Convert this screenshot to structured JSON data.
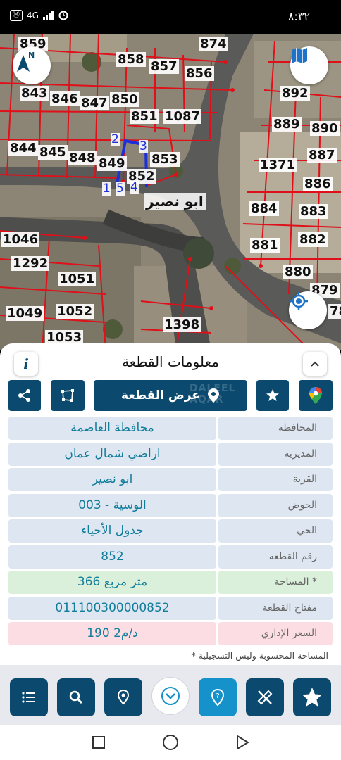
{
  "status_bar": {
    "left_badge": "Ⓜ",
    "network": "4G",
    "time": "٨:٣٢"
  },
  "map": {
    "parcel_numbers": [
      "859",
      "874",
      "858",
      "857",
      "856",
      "843",
      "846",
      "847",
      "850",
      "851",
      "1087",
      "892",
      "889",
      "890",
      "844",
      "845",
      "848",
      "849",
      "853",
      "852",
      "887",
      "1371",
      "886",
      "884",
      "883",
      "881",
      "882",
      "1046",
      "1292",
      "1051",
      "880",
      "879",
      "1049",
      "1052",
      "1053",
      "1398",
      "78"
    ],
    "corner_labels": [
      "2",
      "3",
      "1",
      "5",
      "4"
    ],
    "area_name": "ابو نصير",
    "compass_letter": "N"
  },
  "sheet": {
    "title": "معلومات القطعة",
    "info_label": "i",
    "show_parcel_label": "عرض القطعة",
    "watermark": "DALEEL AQAR",
    "rows": [
      {
        "label": "المحافظة",
        "value": "محافظة العاصمة"
      },
      {
        "label": "المديرية",
        "value": "اراضي شمال عمان"
      },
      {
        "label": "القرية",
        "value": "ابو نصير"
      },
      {
        "label": "الحوض",
        "value": "الوسية - 003"
      },
      {
        "label": "الحي",
        "value": "جدول الأحياء"
      },
      {
        "label": "رقم القطعة",
        "value": "852"
      },
      {
        "label": "المساحة *",
        "value": "366  متر مربع"
      },
      {
        "label": "مفتاح القطعة",
        "value": "011100300000852"
      },
      {
        "label": "السعر الإداري",
        "value": "190 د/م2"
      }
    ],
    "note": "* المساحة المحسوبة وليس التسجيلية"
  },
  "colors": {
    "primary": "#0b4a6e",
    "active": "#1592c9",
    "row_bg": "#dde6f1",
    "area_bg": "#daf0da",
    "price_bg": "#fbdde3",
    "value_text": "#117d9a",
    "parcel_line": "#e0101a",
    "selected_parcel": "#1d2fd8"
  },
  "icons": [
    "menu-icon",
    "search-icon",
    "location-pin-icon",
    "chevron-down-icon",
    "help-pin-icon",
    "ruler-tools-icon",
    "star-icon",
    "share-icon",
    "polygon-icon",
    "google-maps-icon",
    "compass-icon",
    "map-layers-icon",
    "gps-target-icon"
  ]
}
